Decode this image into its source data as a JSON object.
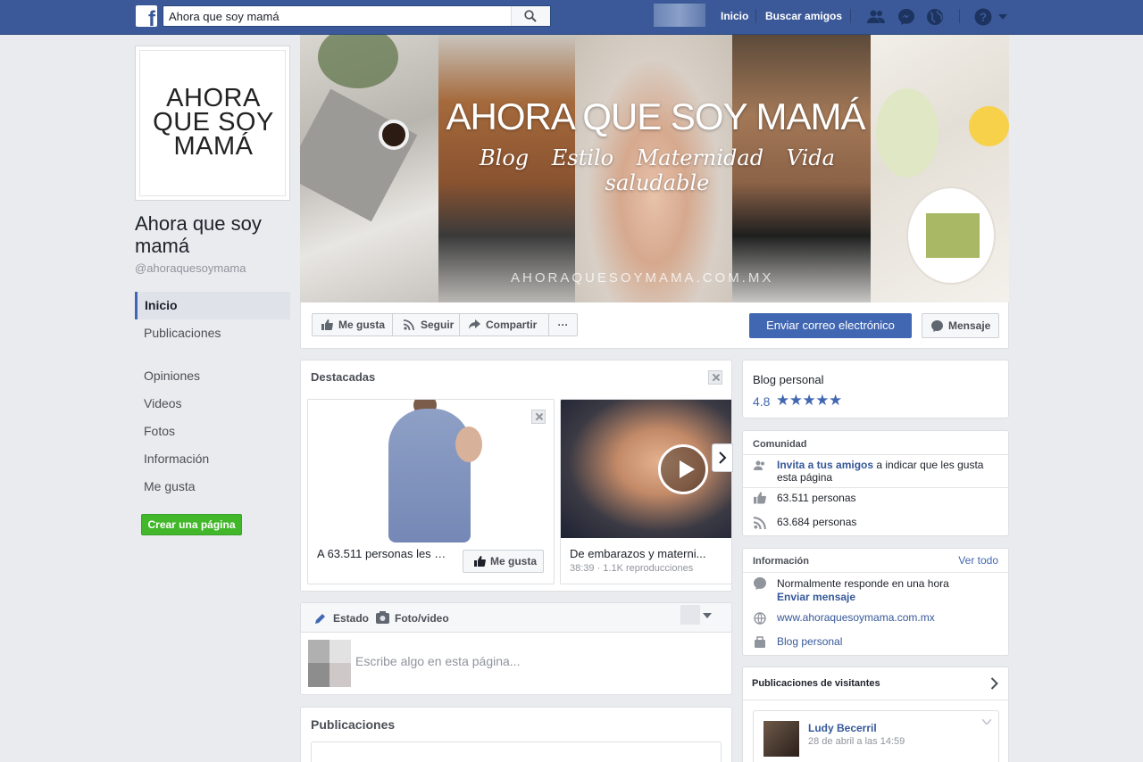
{
  "topbar": {
    "search_value": "Ahora que soy mamá",
    "nav_home": "Inicio",
    "nav_find_friends": "Buscar amigos",
    "brand_color": "#3b5998"
  },
  "page": {
    "logo_text": "AHORA QUE SOY MAMÁ",
    "name": "Ahora que soy mamá",
    "username": "@ahoraquesoymama"
  },
  "leftnav": {
    "items": [
      {
        "label": "Inicio",
        "active": true
      },
      {
        "label": "Publicaciones"
      },
      {
        "label": "Opiniones"
      },
      {
        "label": "Videos"
      },
      {
        "label": "Fotos"
      },
      {
        "label": "Información"
      },
      {
        "label": "Me gusta"
      }
    ],
    "create_page": "Crear una página"
  },
  "cover": {
    "title": "AHORA QUE SOY MAMÁ",
    "tagline": "Blog Estilo Maternidad Vida saludable",
    "url": "AHORAQUESOYMAMA.COM.MX"
  },
  "actions": {
    "like": "Me gusta",
    "follow": "Seguir",
    "share": "Compartir",
    "more": "···",
    "email": "Enviar correo electrónico",
    "message": "Mensaje"
  },
  "featured": {
    "title": "Destacadas",
    "items": [
      {
        "caption": "A 63.511 personas les g...",
        "button": "Me gusta"
      },
      {
        "caption": "De embarazos y materni...",
        "meta": "38:39 · 1.1K reproducciones"
      }
    ]
  },
  "composer": {
    "tab_status": "Estado",
    "tab_photo": "Foto/video",
    "placeholder": "Escribe algo en esta página..."
  },
  "posts": {
    "title": "Publicaciones"
  },
  "sidebar": {
    "category": "Blog personal",
    "rating": "4.8",
    "stars": "★★★★★",
    "community": {
      "title": "Comunidad",
      "invite_link": "Invita a tus amigos",
      "invite_rest": "a indicar que les gusta esta página",
      "likes": "63.511 personas",
      "follows": "63.684 personas"
    },
    "info": {
      "title": "Información",
      "see_all": "Ver todo",
      "response": "Normalmente responde en una hora",
      "send_message": "Enviar mensaje",
      "website": "www.ahoraquesoymama.com.mx",
      "category": "Blog personal"
    },
    "visitors": {
      "title": "Publicaciones de visitantes",
      "post_author": "Ludy Becerril",
      "post_time": "28 de abril a las 14:59"
    }
  }
}
